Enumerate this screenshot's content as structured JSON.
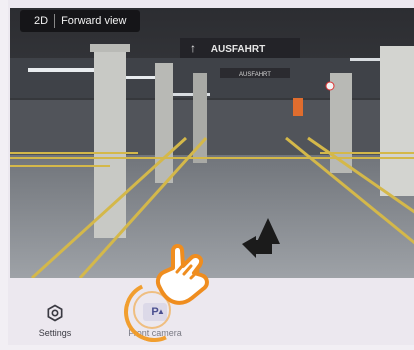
{
  "camera": {
    "view_toggle": {
      "mode_2d": "2D",
      "mode_forward": "Forward view"
    },
    "signs": {
      "exit_main": "AUSFAHRT",
      "exit_secondary": "AUSFAHRT"
    }
  },
  "bottom_nav": {
    "items": [
      {
        "label": "Settings",
        "icon": "settings-icon"
      },
      {
        "label": "Front camera",
        "icon": "front-camera-icon",
        "icon_text": "P"
      }
    ]
  },
  "colors": {
    "floor_lines": "#d4b84a",
    "accent_orange": "#f29b25",
    "toolbar": "#151518"
  }
}
